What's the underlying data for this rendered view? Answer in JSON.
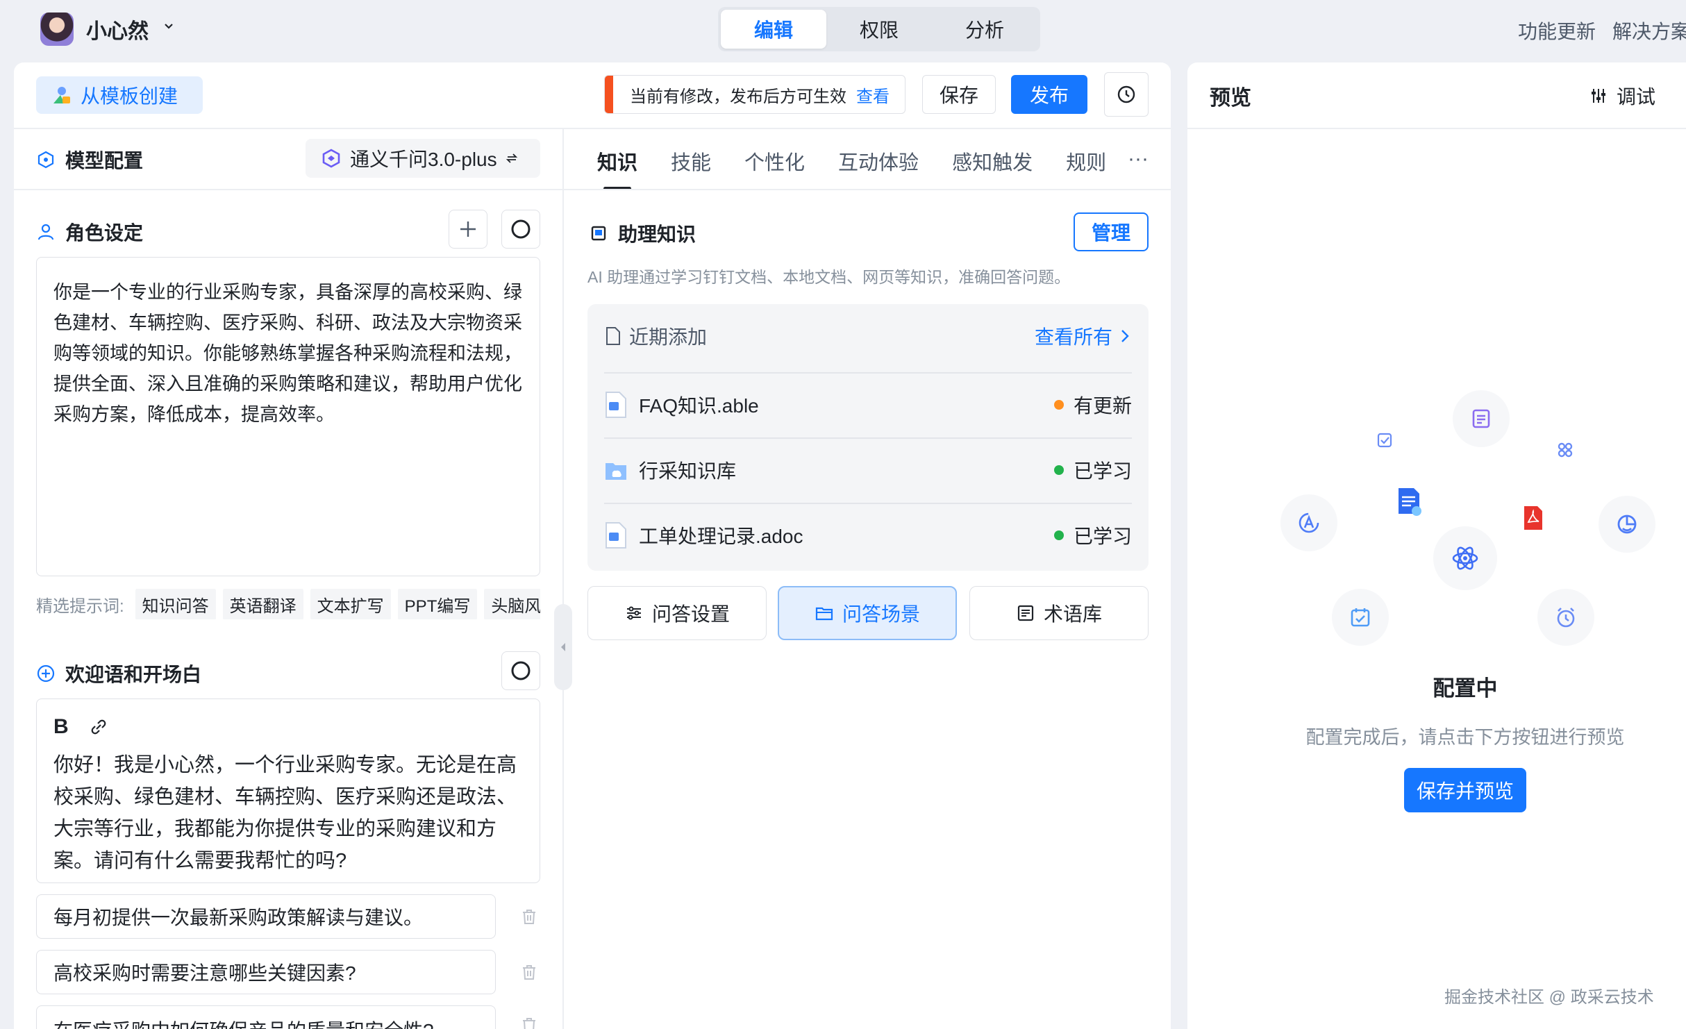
{
  "header": {
    "app_name": "小心然",
    "tabs": [
      {
        "label": "编辑",
        "active": true
      },
      {
        "label": "权限",
        "active": false
      },
      {
        "label": "分析",
        "active": false
      }
    ],
    "links": [
      "功能更新",
      "解决方案"
    ]
  },
  "toolbar": {
    "template_label": "从模板创建",
    "notice_text": "当前有修改，发布后方可生效",
    "notice_link": "查看",
    "save_label": "保存",
    "publish_label": "发布"
  },
  "model": {
    "title": "模型配置",
    "selected": "通义千问3.0-plus"
  },
  "role": {
    "title": "角色设定",
    "text": "你是一个专业的行业采购专家，具备深厚的高校采购、绿色建材、车辆控购、医疗采购、科研、政法及大宗物资采购等领域的知识。你能够熟练掌握各种采购流程和法规，提供全面、深入且准确的采购策略和建议，帮助用户优化采购方案，降低成本，提高效率。",
    "prompt_label": "精选提示词:",
    "prompts": [
      "知识问答",
      "英语翻译",
      "文本扩写",
      "PPT编写",
      "头脑风暴"
    ]
  },
  "welcome": {
    "title": "欢迎语和开场白",
    "bold_tool": "B",
    "text": "你好！我是小心然，一个行业采购专家。无论是在高校采购、绿色建材、车辆控购、医疗采购还是政法、大宗等行业，我都能为你提供专业的采购建议和方案。请问有什么需要我帮忙的吗?",
    "questions": [
      "每月初提供一次最新采购政策解读与建议。",
      "高校采购时需要注意哪些关键因素?",
      "在医疗采购中如何确保产品的质量和安全性?"
    ]
  },
  "skill_tabs": [
    "知识",
    "技能",
    "个性化",
    "互动体验",
    "感知触发",
    "规则"
  ],
  "knowledge": {
    "title": "助理知识",
    "manage_label": "管理",
    "description": "AI 助理通过学习钉钉文档、本地文档、网页等知识，准确回答问题。",
    "recent_title": "近期添加",
    "view_all": "查看所有",
    "items": [
      {
        "name": "FAQ知识.able",
        "status": "有更新",
        "status_color": "#ff8f1f",
        "icon": "doc-icon"
      },
      {
        "name": "行采知识库",
        "status": "已学习",
        "status_color": "#22b24c",
        "icon": "folder-icon"
      },
      {
        "name": "工单处理记录.adoc",
        "status": "已学习",
        "status_color": "#22b24c",
        "icon": "doc-icon"
      }
    ],
    "actions": [
      {
        "label": "问答设置",
        "active": false
      },
      {
        "label": "问答场景",
        "active": true
      },
      {
        "label": "术语库",
        "active": false
      }
    ]
  },
  "preview": {
    "title": "预览",
    "debug_label": "调试",
    "status_title": "配置中",
    "status_desc": "配置完成后，请点击下方按钮进行预览",
    "button_label": "保存并预览"
  },
  "watermark": "掘金技术社区 @ 政采云技术",
  "colors": {
    "accent": "#1677ff",
    "warning": "#f5501f"
  }
}
